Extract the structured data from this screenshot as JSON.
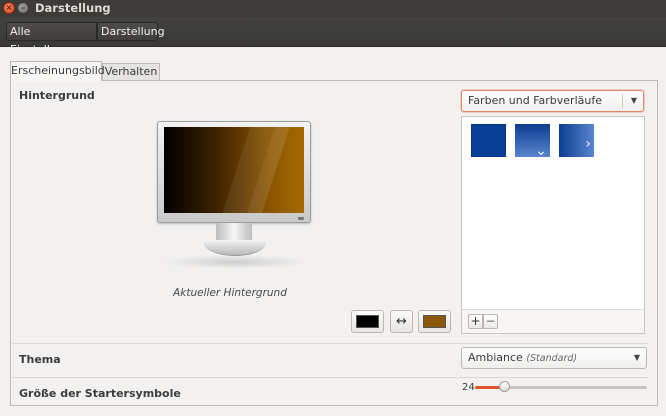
{
  "window": {
    "title": "Darstellung"
  },
  "breadcrumb": {
    "all_settings": "Alle Einstellungen",
    "current": "Darstellung"
  },
  "tabs": [
    {
      "label": "Erscheinungsbild",
      "active": true
    },
    {
      "label": "Verhalten",
      "active": false
    }
  ],
  "background": {
    "section_label": "Hintergrund",
    "caption": "Aktueller Hintergrund",
    "dropdown_value": "Farben und Farbverläufe",
    "primary_color": "#000000",
    "secondary_color": "#8b5700",
    "swap_icon": "↔",
    "add_label": "+",
    "remove_label": "−"
  },
  "theme": {
    "label": "Thema",
    "value": "Ambiance",
    "hint": "(Standard)"
  },
  "launcher": {
    "label": "Größe der Startersymbole",
    "value_text": "24",
    "value": 24,
    "min": 16,
    "max": 64
  }
}
